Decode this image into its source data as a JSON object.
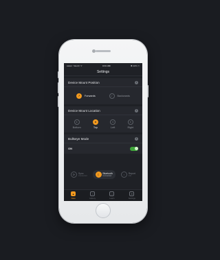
{
  "status_bar": {
    "carrier": "●●●●○ Sketch ᯤ",
    "time": "9:41 AM",
    "battery": "✱ 42% ▭"
  },
  "nav": {
    "title": "Settings"
  },
  "mount_position": {
    "title": "Device Mount Position",
    "options": [
      {
        "label": "Forwards",
        "selected": true
      },
      {
        "label": "Backwards",
        "selected": false
      }
    ]
  },
  "mount_location": {
    "title": "Device Mount Location",
    "options": [
      {
        "label": "Bottom",
        "selected": false
      },
      {
        "label": "Top",
        "selected": true
      },
      {
        "label": "Left",
        "selected": false
      },
      {
        "label": "Right",
        "selected": false
      }
    ]
  },
  "bullseye": {
    "title": "Bullseye Mode",
    "toggle_label": "ON",
    "enabled": true
  },
  "connections": [
    {
      "title": "Sync",
      "subtitle": "Connected",
      "active": false
    },
    {
      "title": "Bluetooth",
      "subtitle": "Connected",
      "active": true
    },
    {
      "title": "Report",
      "subtitle": "Info",
      "active": false
    }
  ],
  "tabs": [
    {
      "label": "Data",
      "active": true
    },
    {
      "label": "History",
      "active": false
    },
    {
      "label": "Learn",
      "active": false
    },
    {
      "label": "Settings",
      "active": false
    }
  ],
  "accent_color": "#f39a1e",
  "toggle_color": "#3fa43a"
}
